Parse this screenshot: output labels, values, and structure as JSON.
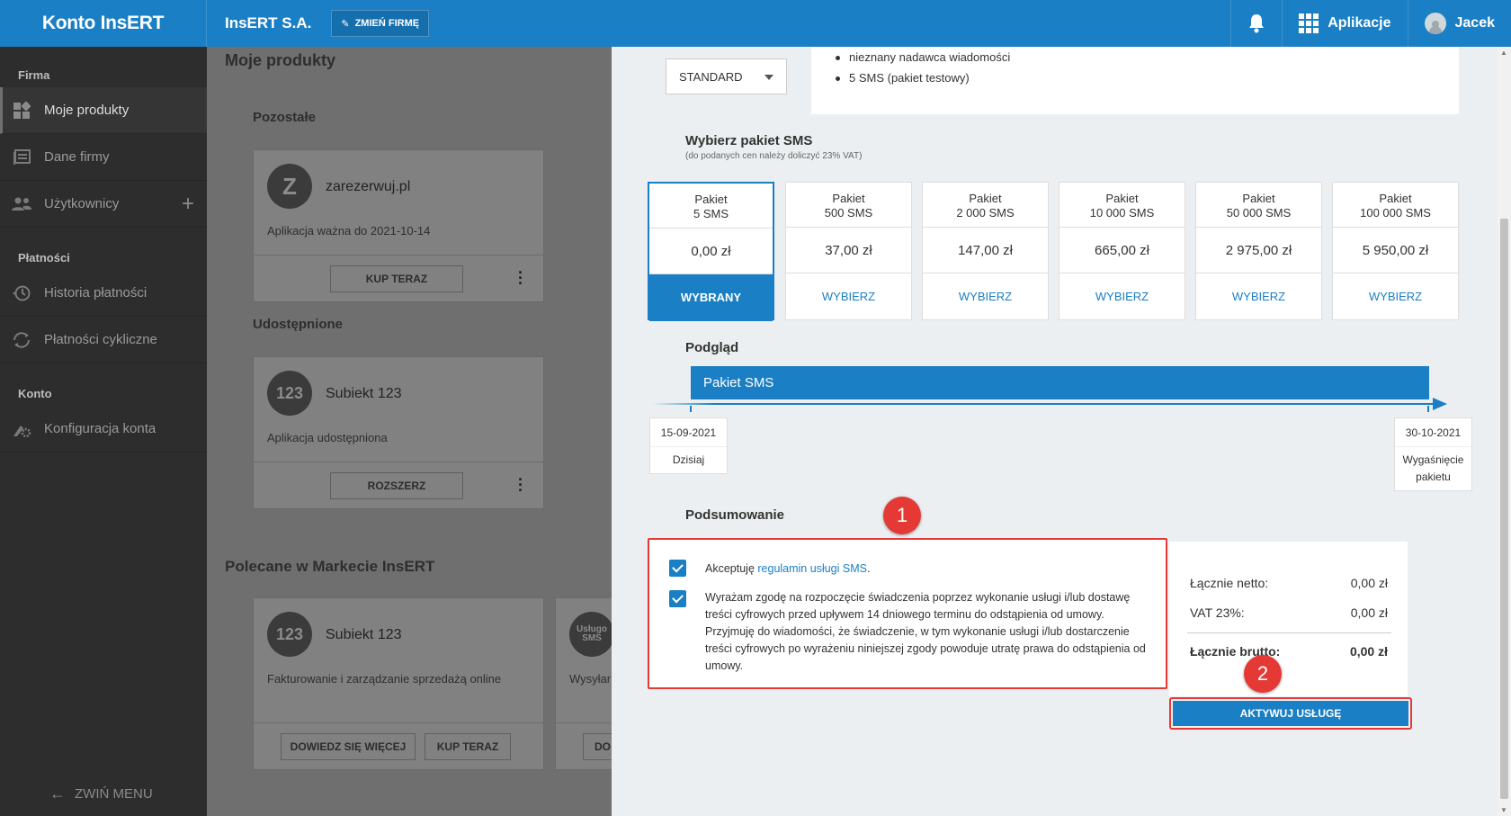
{
  "topbar": {
    "logo": "Konto InsERT",
    "company": "InsERT S.A.",
    "change_company": "ZMIEŃ FIRMĘ",
    "apps": "Aplikacje",
    "user": "Jacek"
  },
  "sidebar": {
    "section_firma": "Firma",
    "items_firma": [
      {
        "label": "Moje produkty",
        "icon": "products-icon"
      },
      {
        "label": "Dane firmy",
        "icon": "company-data-icon"
      },
      {
        "label": "Użytkownicy",
        "icon": "users-icon"
      }
    ],
    "section_platnosci": "Płatności",
    "items_platnosci": [
      {
        "label": "Historia płatności",
        "icon": "history-icon"
      },
      {
        "label": "Płatności cykliczne",
        "icon": "recurring-payments-icon"
      }
    ],
    "section_konto": "Konto",
    "items_konto": [
      {
        "label": "Konfiguracja konta",
        "icon": "gear-icon"
      }
    ],
    "collapse": "ZWIŃ MENU"
  },
  "main": {
    "title": "Moje produkty",
    "section_other": "Pozostałe",
    "card1": {
      "badge": "Z",
      "title": "zarezerwuj.pl",
      "desc": "Aplikacja ważna do 2021-10-14",
      "button": "KUP TERAZ"
    },
    "section_shared": "Udostępnione",
    "card2": {
      "badge": "123",
      "title": "Subiekt 123",
      "desc": "Aplikacja udostępniona",
      "button": "ROZSZERZ"
    },
    "section_recommended": "Polecane w Markecie InsERT",
    "card3": {
      "badge": "123",
      "title": "Subiekt 123",
      "desc": "Fakturowanie i zarządzanie sprzedażą online",
      "button1": "DOWIEDZ SIĘ WIĘCEJ",
      "button2": "KUP TERAZ"
    },
    "card4": {
      "badge_line1": "Usługo",
      "badge_line2": "SMS",
      "desc": "Wysyłar",
      "button": "DO"
    }
  },
  "panel": {
    "select_value": "STANDARD",
    "features": [
      "nieznany nadawca wiadomości",
      "5 SMS (pakiet testowy)"
    ],
    "packages_title": "Wybierz pakiet SMS",
    "packages_subtitle": "(do podanych cen należy doliczyć 23% VAT)",
    "packages": [
      {
        "line1": "Pakiet",
        "line2": "5 SMS",
        "price": "0,00 zł",
        "action": "WYBRANY",
        "selected": true
      },
      {
        "line1": "Pakiet",
        "line2": "500 SMS",
        "price": "37,00 zł",
        "action": "WYBIERZ",
        "selected": false
      },
      {
        "line1": "Pakiet",
        "line2": "2 000 SMS",
        "price": "147,00 zł",
        "action": "WYBIERZ",
        "selected": false
      },
      {
        "line1": "Pakiet",
        "line2": "10 000 SMS",
        "price": "665,00 zł",
        "action": "WYBIERZ",
        "selected": false
      },
      {
        "line1": "Pakiet",
        "line2": "50 000 SMS",
        "price": "2 975,00 zł",
        "action": "WYBIERZ",
        "selected": false
      },
      {
        "line1": "Pakiet",
        "line2": "100 000 SMS",
        "price": "5 950,00 zł",
        "action": "WYBIERZ",
        "selected": false
      }
    ],
    "preview_title": "Podgląd",
    "timeline_label": "Pakiet SMS",
    "start_date": "15-09-2021",
    "start_label": "Dzisiaj",
    "end_date": "30-10-2021",
    "end_label_line1": "Wygaśnięcie",
    "end_label_line2": "pakietu",
    "summary_title": "Podsumowanie",
    "consent1_prefix": "Akceptuję ",
    "consent1_link": "regulamin usługi SMS",
    "consent1_suffix": ".",
    "consent2": "Wyrażam zgodę na rozpoczęcie świadczenia poprzez wykonanie usługi i/lub dostawę treści cyfrowych przed upływem 14 dniowego terminu do odstąpienia od umowy. Przyjmuję do wiadomości, że świadczenie, w tym wykonanie usługi i/lub dostarczenie treści cyfrowych po wyrażeniu niniejszej zgody powoduje utratę prawa do odstąpienia od umowy.",
    "net_label": "Łącznie netto:",
    "net_value": "0,00 zł",
    "vat_label": "VAT 23%:",
    "vat_value": "0,00 zł",
    "gross_label": "Łącznie brutto:",
    "gross_value": "0,00 zł",
    "activate": "AKTYWUJ USŁUGĘ",
    "marker1": "1",
    "marker2": "2"
  },
  "colors": {
    "accent": "#1a7fc4",
    "marker": "#e53935",
    "sidebar": "#2d2d2d"
  }
}
